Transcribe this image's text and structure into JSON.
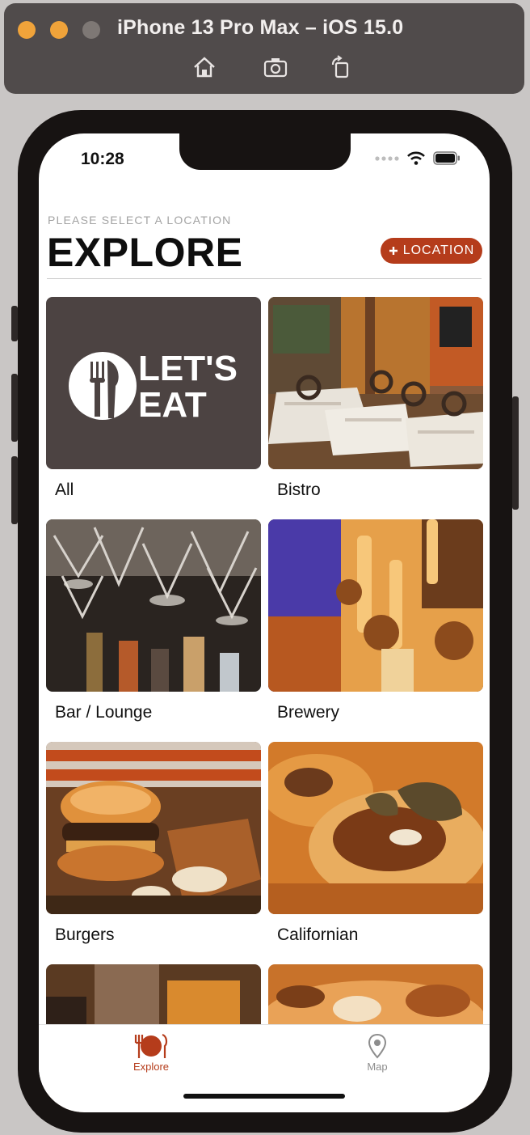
{
  "simulator": {
    "title": "iPhone 13 Pro Max – iOS 15.0",
    "tools": [
      "home-icon",
      "screenshot-icon",
      "rotate-icon"
    ]
  },
  "status_bar": {
    "time": "10:28"
  },
  "header": {
    "subtitle": "PLEASE SELECT A LOCATION",
    "title": "EXPLORE",
    "location_button": "LOCATION"
  },
  "colors": {
    "accent": "#b53c1b",
    "logo_bg": "#4c4342"
  },
  "categories": [
    {
      "label": "All",
      "image": "lets-eat-logo",
      "logo_line1": "LET'S",
      "logo_line2": "EAT"
    },
    {
      "label": "Bistro",
      "image": "bistro-photo"
    },
    {
      "label": "Bar / Lounge",
      "image": "bar-photo"
    },
    {
      "label": "Brewery",
      "image": "brewery-photo"
    },
    {
      "label": "Burgers",
      "image": "burgers-photo"
    },
    {
      "label": "Californian",
      "image": "californian-photo"
    },
    {
      "label": "",
      "image": "partial-photo-1"
    },
    {
      "label": "",
      "image": "partial-photo-2"
    }
  ],
  "tabs": [
    {
      "label": "Explore",
      "icon": "plate-fork-knife-icon",
      "selected": true
    },
    {
      "label": "Map",
      "icon": "map-pin-icon",
      "selected": false
    }
  ]
}
